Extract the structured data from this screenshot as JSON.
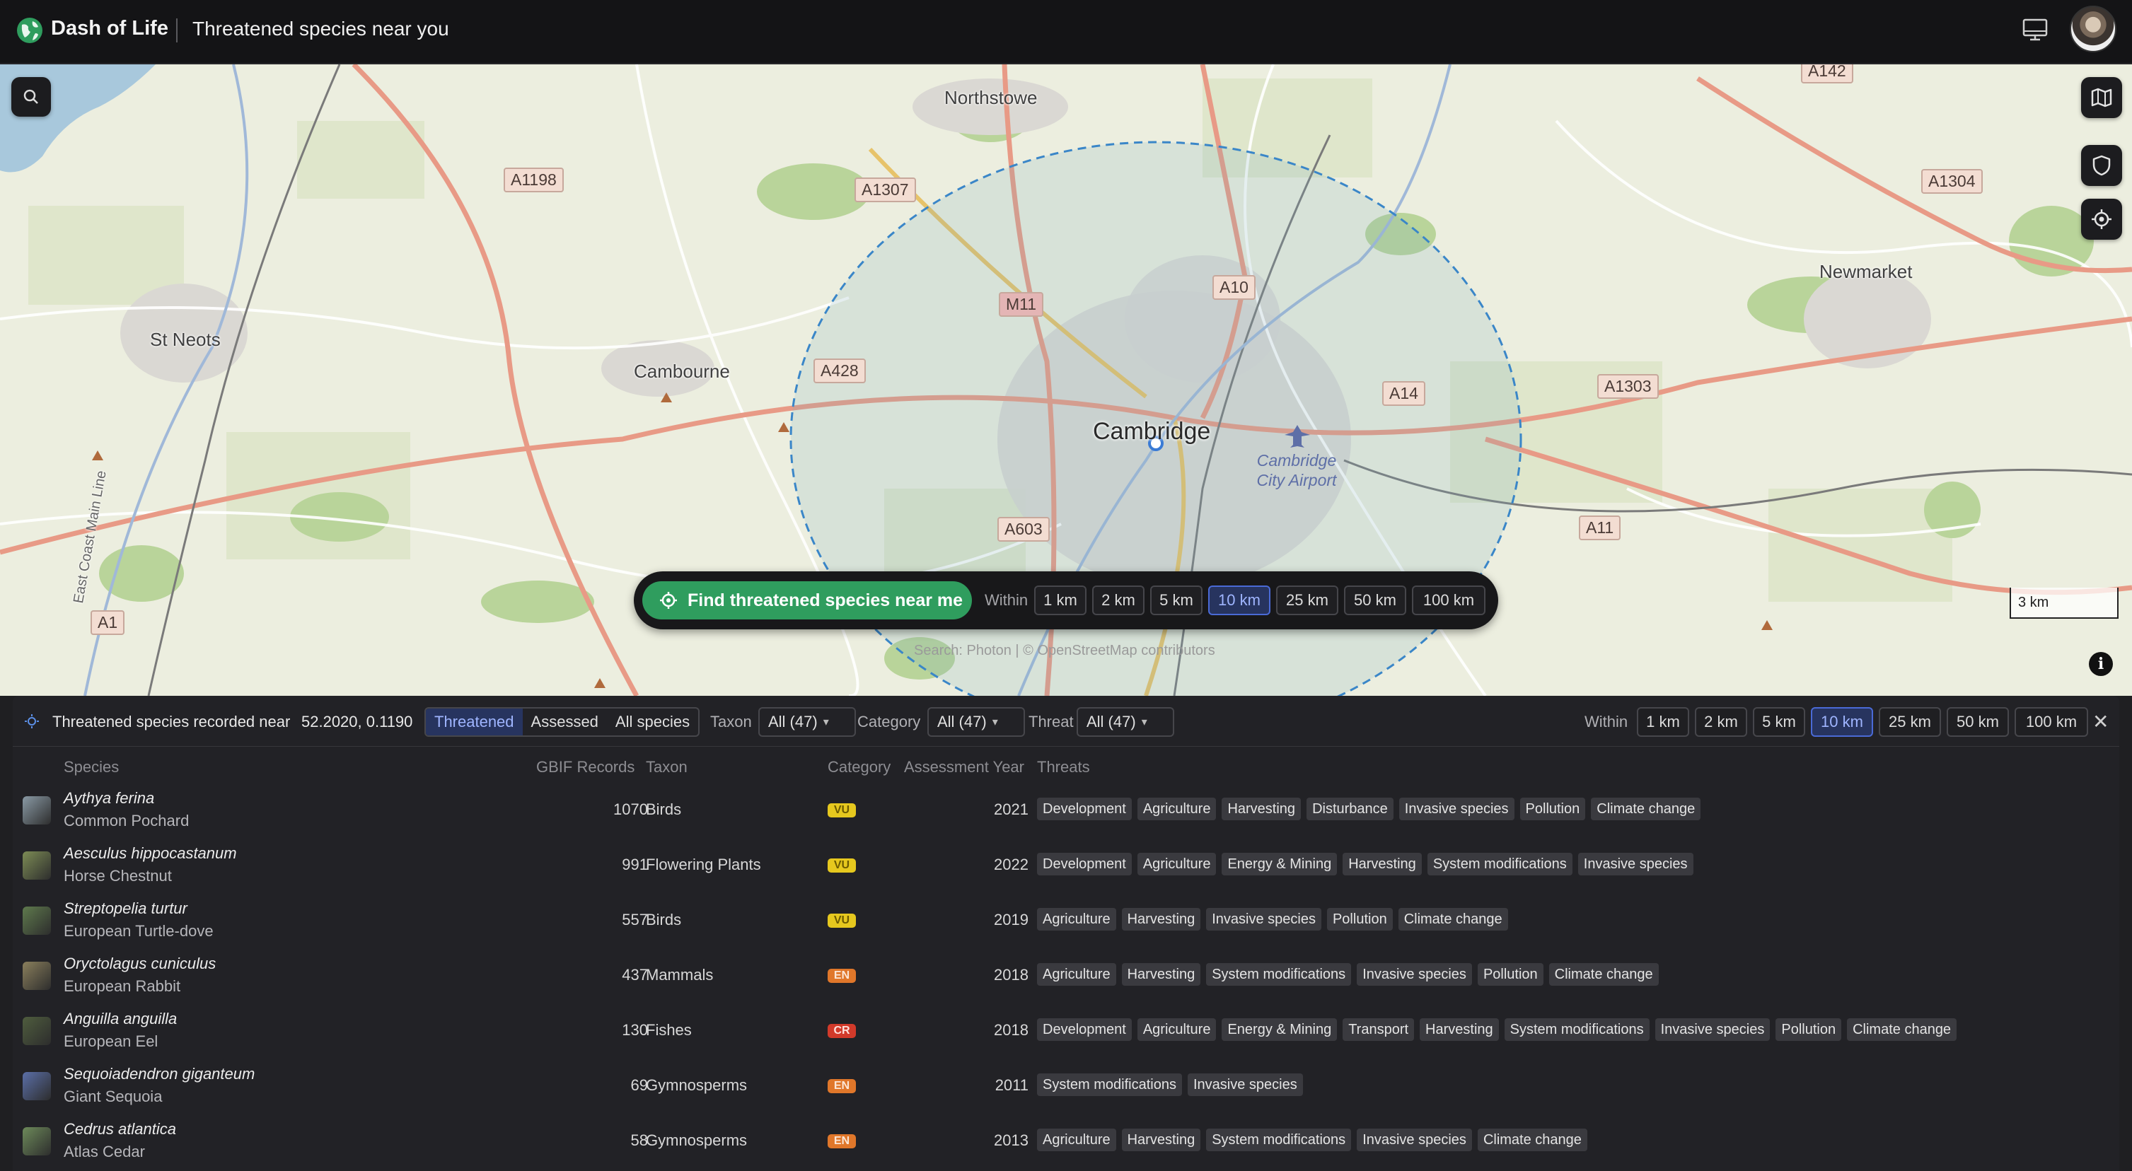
{
  "app": {
    "name": "Dash of Life",
    "page_title": "Threatened species near you"
  },
  "map": {
    "places": {
      "northstowe": "Northstowe",
      "st_neots": "St Neots",
      "cambourne": "Cambourne",
      "cambridge": "Cambridge",
      "newmarket": "Newmarket",
      "airport": "Cambridge City Airport",
      "main_line": "East Coast Main Line"
    },
    "roads": {
      "a1198": "A1198",
      "a1307": "A1307",
      "m11": "M11",
      "a10": "A10",
      "a428": "A428",
      "a14": "A14",
      "a1303": "A1303",
      "a1304": "A1304",
      "a142": "A142",
      "a603": "A603",
      "a11": "A11",
      "a1": "A1"
    },
    "scale": "3 km",
    "attribution": "Search: Photon | © OpenStreetMap contributors"
  },
  "finder": {
    "button_label": "Find threatened species near me",
    "within_label": "Within",
    "radius_options": [
      "1 km",
      "2 km",
      "5 km",
      "10 km",
      "25 km",
      "50 km",
      "100 km"
    ],
    "selected_radius": "10 km"
  },
  "panel": {
    "title": "Threatened species recorded near",
    "coords": "52.2020, 0.1190",
    "filters": {
      "status_tabs": [
        "Threatened",
        "Assessed",
        "All species"
      ],
      "selected_status": "Threatened",
      "taxon_label": "Taxon",
      "taxon_value": "All (47)",
      "category_label": "Category",
      "category_value": "All (47)",
      "threat_label": "Threat",
      "threat_value": "All (47)"
    },
    "within_label": "Within",
    "radius_options": [
      "1 km",
      "2 km",
      "5 km",
      "10 km",
      "25 km",
      "50 km",
      "100 km"
    ],
    "selected_radius": "10 km",
    "columns": [
      "Species",
      "GBIF Records",
      "Taxon",
      "Category",
      "Assessment Year",
      "Threats"
    ],
    "rows": [
      {
        "scientific": "Aythya ferina",
        "common": "Common Pochard",
        "records": "1070",
        "taxon": "Birds",
        "category": "VU",
        "year": "2021",
        "threats": [
          "Development",
          "Agriculture",
          "Harvesting",
          "Disturbance",
          "Invasive species",
          "Pollution",
          "Climate change"
        ],
        "thumb_color": "#8a9aa5"
      },
      {
        "scientific": "Aesculus hippocastanum",
        "common": "Horse Chestnut",
        "records": "991",
        "taxon": "Flowering Plants",
        "category": "VU",
        "year": "2022",
        "threats": [
          "Development",
          "Agriculture",
          "Energy & Mining",
          "Harvesting",
          "System modifications",
          "Invasive species"
        ],
        "thumb_color": "#7d8c55"
      },
      {
        "scientific": "Streptopelia turtur",
        "common": "European Turtle-dove",
        "records": "557",
        "taxon": "Birds",
        "category": "VU",
        "year": "2019",
        "threats": [
          "Agriculture",
          "Harvesting",
          "Invasive species",
          "Pollution",
          "Climate change"
        ],
        "thumb_color": "#5f7a4d"
      },
      {
        "scientific": "Oryctolagus cuniculus",
        "common": "European Rabbit",
        "records": "437",
        "taxon": "Mammals",
        "category": "EN",
        "year": "2018",
        "threats": [
          "Agriculture",
          "Harvesting",
          "System modifications",
          "Invasive species",
          "Pollution",
          "Climate change"
        ],
        "thumb_color": "#8a7f5c"
      },
      {
        "scientific": "Anguilla anguilla",
        "common": "European Eel",
        "records": "130",
        "taxon": "Fishes",
        "category": "CR",
        "year": "2018",
        "threats": [
          "Development",
          "Agriculture",
          "Energy & Mining",
          "Transport",
          "Harvesting",
          "System modifications",
          "Invasive species",
          "Pollution",
          "Climate change"
        ],
        "thumb_color": "#4f5d3e"
      },
      {
        "scientific": "Sequoiadendron giganteum",
        "common": "Giant Sequoia",
        "records": "69",
        "taxon": "Gymnosperms",
        "category": "EN",
        "year": "2011",
        "threats": [
          "System modifications",
          "Invasive species"
        ],
        "thumb_color": "#5b6fa8"
      },
      {
        "scientific": "Cedrus atlantica",
        "common": "Atlas Cedar",
        "records": "58",
        "taxon": "Gymnosperms",
        "category": "EN",
        "year": "2013",
        "threats": [
          "Agriculture",
          "Harvesting",
          "System modifications",
          "Invasive species",
          "Climate change"
        ],
        "thumb_color": "#6d8a5a"
      }
    ]
  }
}
